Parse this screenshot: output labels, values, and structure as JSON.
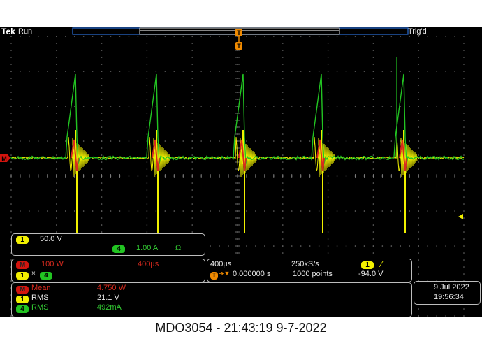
{
  "topbar": {
    "brand": "Tek",
    "run_state": "Run",
    "trigger_status": "Trig'd"
  },
  "markers": {
    "ch_math_marker": "M",
    "trigger_top_marker": "T"
  },
  "channel1_box": {
    "chip": "1",
    "scale": "50.0 V",
    "ch4_chip": "4",
    "ch4_scale": "1.00 A",
    "ch4_unit_icon": "ohm-icon",
    "ch4_unit": "Ω"
  },
  "math_box": {
    "math_chip": "M",
    "math_scale": "100 W",
    "math_time": "400µs",
    "op_chip1": "1",
    "op_symbol": "×",
    "op_chip2": "4"
  },
  "timebase_box": {
    "timebase": "400µs",
    "sample_rate": "250kS/s",
    "trigger_chip": "1",
    "trigger_slope_icon": "rising-edge-icon",
    "trigger_slope": "∕",
    "position_icon": "trigger-position-icon",
    "position_glyph": "T",
    "position_arrow": "➔▼",
    "position": "0.000000 s",
    "record_length": "1000 points",
    "trigger_level": "-94.0 V"
  },
  "datetime_box": {
    "date": "9 Jul  2022",
    "time": "19:56:34"
  },
  "measurements": [
    {
      "chip": "M",
      "label": "Mean",
      "value": "4.750 W",
      "color": "#d92a1e"
    },
    {
      "chip": "1",
      "label": "RMS",
      "value": "21.1 V",
      "color": "#f0f000"
    },
    {
      "chip": "4",
      "label": "RMS",
      "value": "492mA",
      "color": "#33cc33"
    }
  ],
  "caption": "MDO3054 - 21:43:19   9-7-2022",
  "colors": {
    "ch1": "#f0f000",
    "ch4": "#22c422",
    "math": "#d92a1e",
    "accent_orange": "#f08a00",
    "record_bar": "#2a6fd6"
  }
}
